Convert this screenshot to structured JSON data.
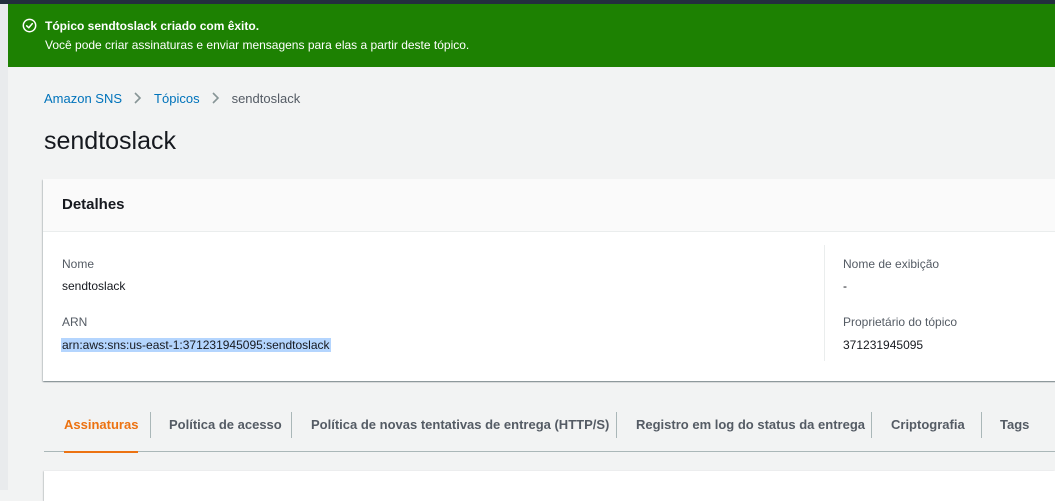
{
  "flash": {
    "title": "Tópico sendtoslack criado com êxito.",
    "message": "Você pode criar assinaturas e enviar mensagens para elas a partir deste tópico.",
    "color": "#1d8102"
  },
  "breadcrumb": {
    "items": [
      "Amazon SNS",
      "Tópicos"
    ],
    "current": "sendtoslack"
  },
  "page_title": "sendtoslack",
  "details": {
    "header": "Detalhes",
    "name_label": "Nome",
    "name_value": "sendtoslack",
    "arn_label": "ARN",
    "arn_value": "arn:aws:sns:us-east-1:371231945095:sendtoslack",
    "display_name_label": "Nome de exibição",
    "display_name_value": "-",
    "owner_label": "Proprietário do tópico",
    "owner_value": "371231945095"
  },
  "tabs": [
    {
      "label": "Assinaturas",
      "active": true
    },
    {
      "label": "Política de acesso",
      "active": false
    },
    {
      "label": "Política de novas tentativas de entrega (HTTP/S)",
      "active": false
    },
    {
      "label": "Registro em log do status da entrega",
      "active": false
    },
    {
      "label": "Criptografia",
      "active": false
    },
    {
      "label": "Tags",
      "active": false
    }
  ],
  "colors": {
    "link": "#0073bb",
    "active_tab": "#ec7211"
  }
}
